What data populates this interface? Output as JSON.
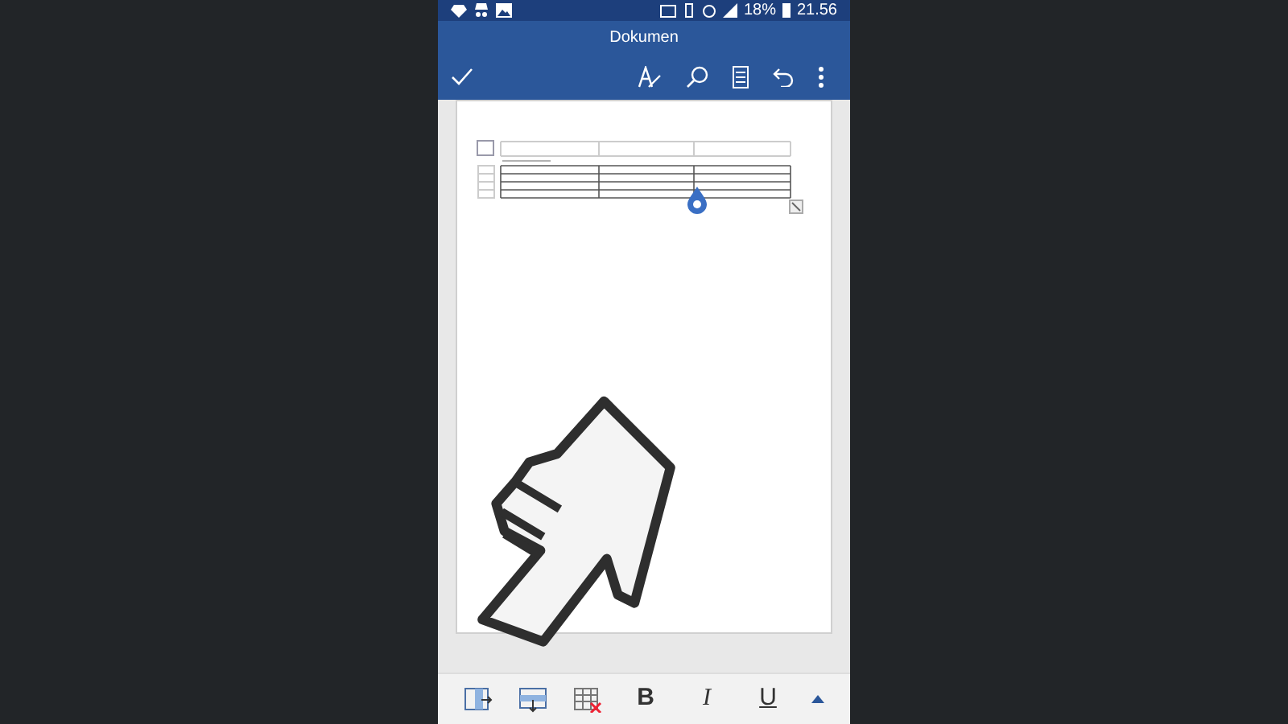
{
  "status_bar": {
    "battery": "18%",
    "time": "21.56"
  },
  "title_bar": {
    "title": "Dokumen"
  },
  "format_toolbar": [
    {
      "kind": "insert-column"
    },
    {
      "kind": "insert-row"
    },
    {
      "kind": "delete-table"
    },
    {
      "kind": "bold",
      "label": "B"
    },
    {
      "kind": "italic",
      "label": "I"
    },
    {
      "kind": "underline",
      "label": "U"
    },
    {
      "kind": "expand"
    }
  ]
}
